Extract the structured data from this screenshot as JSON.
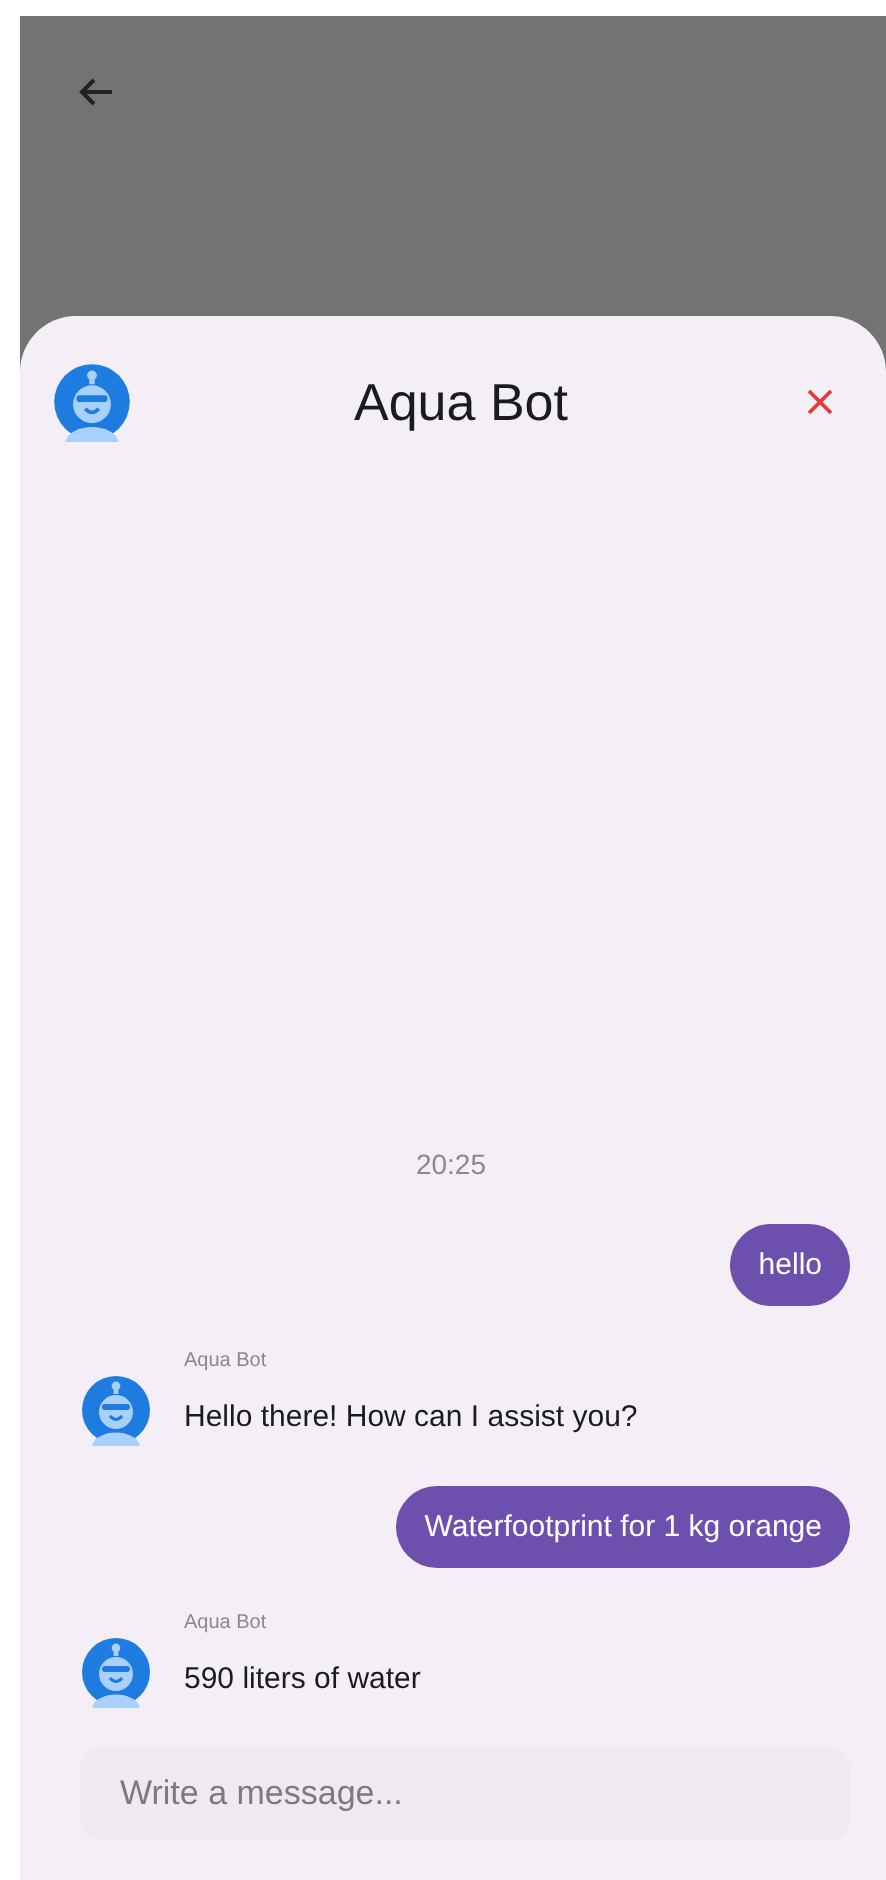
{
  "header": {
    "title": "Aqua Bot"
  },
  "timestamp": "20:25",
  "messages": [
    {
      "kind": "user",
      "text": "hello"
    },
    {
      "kind": "bot",
      "sender": "Aqua Bot",
      "text": "Hello there! How can I assist you?"
    },
    {
      "kind": "user",
      "text": "Waterfootprint for 1 kg orange"
    },
    {
      "kind": "bot",
      "sender": "Aqua Bot",
      "text": "590 liters of water"
    }
  ],
  "composer": {
    "placeholder": "Write a message..."
  }
}
